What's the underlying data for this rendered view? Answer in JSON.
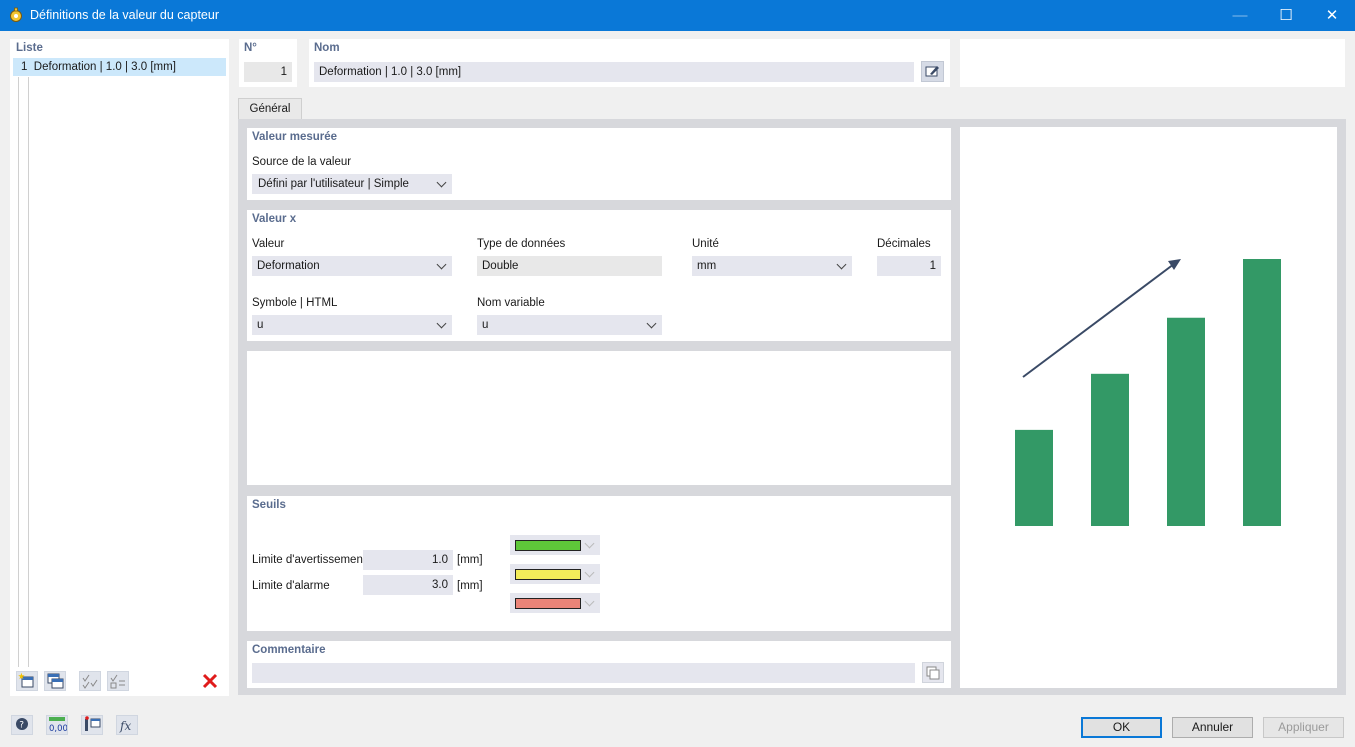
{
  "window": {
    "title": "Définitions de la valeur du capteur",
    "minimize_glyph": "—",
    "maximize_glyph": "☐",
    "close_glyph": "✕"
  },
  "list": {
    "header": "Liste",
    "items": [
      {
        "number": "1",
        "label": "Deformation | 1.0 | 3.0 [mm]"
      }
    ],
    "tools": [
      "new-item-icon",
      "copy-item-icon",
      "check-all-icon",
      "uncheck-all-icon",
      "delete-icon"
    ]
  },
  "header": {
    "number_label": "N°",
    "number_value": "1",
    "name_label": "Nom",
    "name_value": "Deformation | 1.0 | 3.0 [mm]",
    "edit_icon": "edit-name-icon"
  },
  "tabs": [
    {
      "label": "Général"
    }
  ],
  "measured_value": {
    "title": "Valeur mesurée",
    "source_label": "Source de la valeur",
    "source_value": "Défini par l'utilisateur | Simple"
  },
  "x_value": {
    "title": "Valeur x",
    "value_label": "Valeur",
    "value": "Deformation",
    "datatype_label": "Type de données",
    "datatype": "Double",
    "unit_label": "Unité",
    "unit": "mm",
    "decimals_label": "Décimales",
    "decimals": "1",
    "symbol_label": "Symbole | HTML",
    "symbol": "u",
    "variable_label": "Nom variable",
    "variable": "u"
  },
  "thresholds": {
    "title": "Seuils",
    "warning_label": "Limite d'avertissemen",
    "warning_value": "1.0",
    "warning_unit": "[mm]",
    "alarm_label": "Limite d'alarme",
    "alarm_value": "3.0",
    "alarm_unit": "[mm]",
    "colors": [
      "#5ec639",
      "#f2ec5a",
      "#ea8478"
    ]
  },
  "comment": {
    "title": "Commentaire",
    "value": ""
  },
  "preview": {
    "bar_color": "#339966",
    "arrow_color": "#3a4a66",
    "bar_levels": [
      0.36,
      0.57,
      0.78,
      1.0
    ]
  },
  "bottom_tools": [
    "help-icon",
    "units-icon",
    "display-settings-icon",
    "formula-icon"
  ],
  "buttons": {
    "ok": "OK",
    "cancel": "Annuler",
    "apply": "Appliquer"
  }
}
